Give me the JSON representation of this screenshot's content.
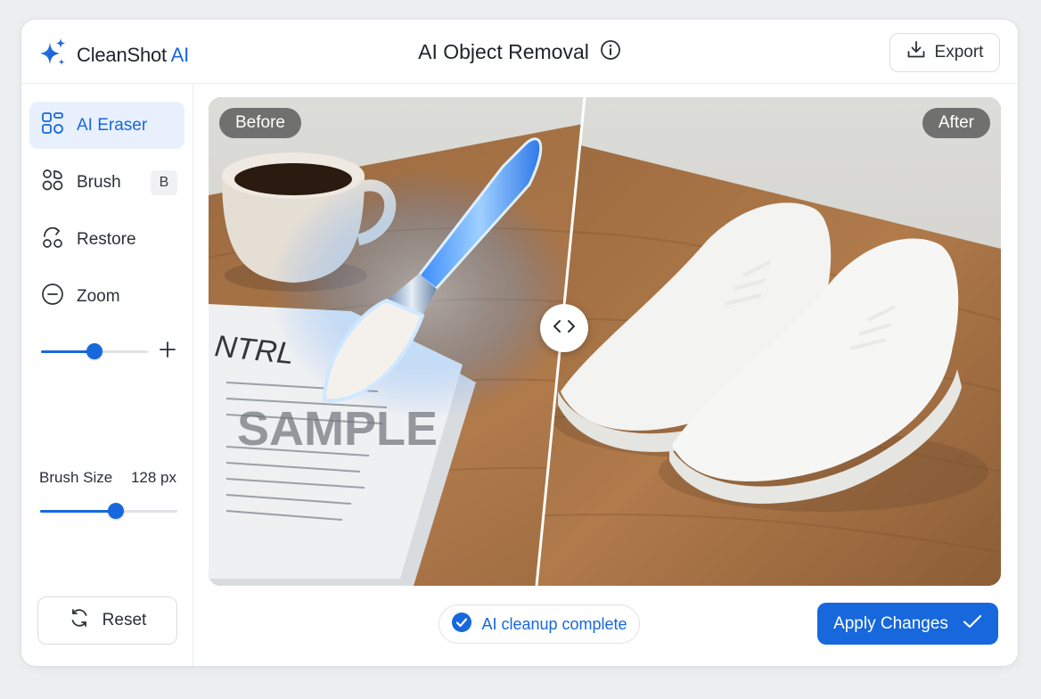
{
  "brand": {
    "name": "CleanShot",
    "ai": "AI"
  },
  "header": {
    "title": "AI Object Removal",
    "export_label": "Export"
  },
  "sidebar": {
    "tools": [
      {
        "label": "AI Eraser",
        "active": true
      },
      {
        "label": "Brush",
        "shortcut": "B"
      },
      {
        "label": "Restore"
      },
      {
        "label": "Zoom"
      }
    ],
    "zoom_level": 0.5,
    "brush_size_label": "Brush Size",
    "brush_size_value": "128 px",
    "brush_size_level": 0.55,
    "reset_label": "Reset"
  },
  "canvas": {
    "before_label": "Before",
    "after_label": "After",
    "paper_text_1": "NTRL",
    "paper_text_2": "SAMPLE"
  },
  "footer": {
    "status_text": "AI cleanup complete",
    "apply_label": "Apply Changes"
  },
  "colors": {
    "accent": "#1668dc",
    "accent_light": "#e8f0fe"
  }
}
